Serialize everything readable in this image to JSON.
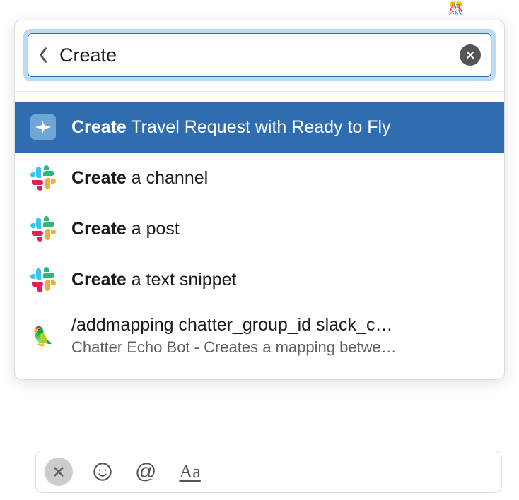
{
  "decor": {
    "confetti": "🎊"
  },
  "search": {
    "value": "Create"
  },
  "results": [
    {
      "icon": "plane-icon",
      "bold": "Create",
      "rest": " Travel Request with Ready to Fly",
      "highlighted": true
    },
    {
      "icon": "slack-hash-icon",
      "bold": "Create",
      "rest": " a channel",
      "highlighted": false
    },
    {
      "icon": "slack-hash-icon",
      "bold": "Create",
      "rest": " a post",
      "highlighted": false
    },
    {
      "icon": "slack-hash-icon",
      "bold": "Create",
      "rest": " a text snippet",
      "highlighted": false
    },
    {
      "icon": "parrot-icon",
      "bold": "",
      "rest": "/addmapping chatter_group_id slack_c…",
      "subtitle": "Chatter Echo Bot - Creates a mapping betwe…",
      "highlighted": false
    }
  ],
  "compose": {
    "close": "×",
    "emoji": "☺",
    "mention": "@",
    "format": "Aa"
  },
  "icons": {
    "parrot_glyph": "🦜"
  }
}
